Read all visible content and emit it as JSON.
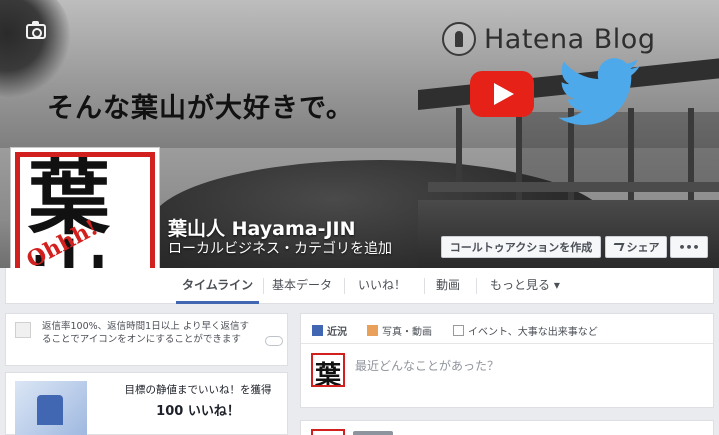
{
  "cover": {
    "tagline": "そんな葉山が大好きで。",
    "hatena_label": "Hatena Blog",
    "icons": [
      "camera-icon",
      "hatena-icon",
      "youtube-icon",
      "twitter-icon"
    ]
  },
  "profile": {
    "logo_kanji": "葉山人",
    "logo_sub": "Ohhh!",
    "name": "葉山人 Hayama-JIN",
    "category_link": "ローカルビジネス・カテゴリを追加"
  },
  "actions": {
    "cta": "コールトゥアクションを作成",
    "share": "シェア",
    "more": "•••"
  },
  "tabs": [
    "タイムライン",
    "基本データ",
    "いいね！",
    "動画",
    "もっと見る ▾"
  ],
  "response_card": {
    "text": "返信率100%、返信時間1日以上 より早く返信することでアイコンをオンにすることができます"
  },
  "goal_card": {
    "text": "目標の静値までいいね！を獲得",
    "count": "100 いいね！"
  },
  "composer": {
    "tab_status": "近況",
    "tab_photo": "写真・動画",
    "tab_event": "イベント、大事な出来事など",
    "placeholder": "最近どんなことがあった？",
    "avatar_text": "葉"
  },
  "colors": {
    "accent": "#4267b2",
    "brand_red": "#d2201e",
    "youtube": "#e62117",
    "twitter": "#4ea9ea"
  }
}
